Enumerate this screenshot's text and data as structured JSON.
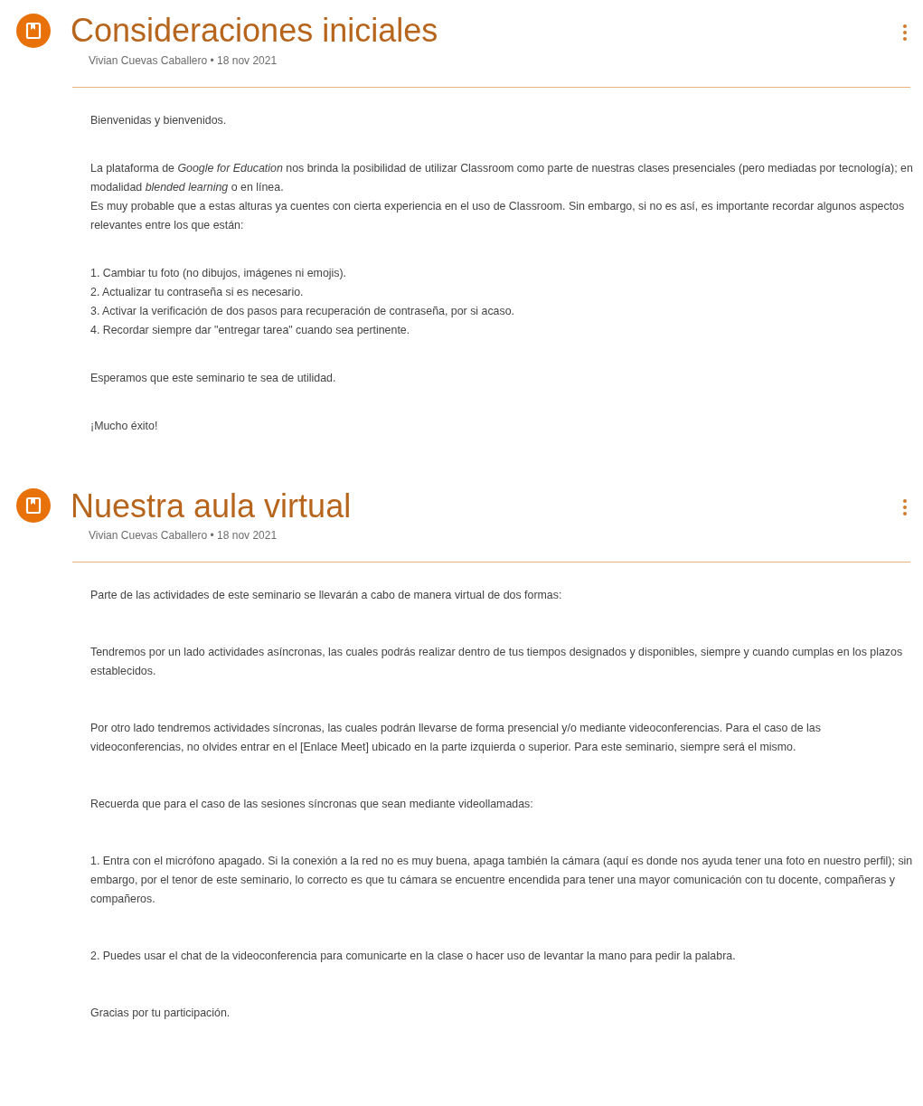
{
  "posts": [
    {
      "title": "Consideraciones iniciales",
      "author": "Vivian Cuevas Caballero",
      "date": "18 nov 2021",
      "separator": "•",
      "paragraphs": [
        {
          "lines": [
            "Bienvenidas y bienvenidos."
          ]
        },
        {
          "lines": [
            "La plataforma de *Google for Education* nos brinda la posibilidad de utilizar Classroom como parte de nuestras clases presenciales (pero mediadas por tecnología); en modalidad *blended learning* o en línea.",
            "Es muy probable que a estas alturas ya cuentes con cierta experiencia en el uso de Classroom. Sin embargo, si no es así, es importante recordar algunos aspectos relevantes entre los que están:"
          ]
        },
        {
          "lines": [
            "1. Cambiar tu foto (no dibujos, imágenes ni emojis).",
            "2. Actualizar tu contraseña si es necesario.",
            "3. Activar la verificación de dos pasos para recuperación de contraseña, por si acaso.",
            "4. Recordar siempre dar \"entregar tarea\" cuando sea pertinente."
          ]
        },
        {
          "lines": [
            "Esperamos que este seminario te sea de utilidad."
          ]
        },
        {
          "lines": [
            "¡Mucho éxito!"
          ]
        }
      ]
    },
    {
      "title": "Nuestra aula virtual",
      "author": "Vivian Cuevas Caballero",
      "date": "18 nov 2021",
      "separator": "•",
      "paragraphs": [
        {
          "lines": [
            "Parte de las actividades de este seminario se llevarán a cabo de manera virtual de dos formas:"
          ]
        },
        {
          "lines": [
            "Tendremos por un lado actividades asíncronas, las cuales podrás realizar dentro de tus tiempos designados y disponibles, siempre y cuando cumplas en los plazos establecidos."
          ]
        },
        {
          "lines": [
            "Por otro lado tendremos actividades síncronas, las cuales podrán llevarse de forma presencial y/o mediante videoconferencias. Para el caso de las videoconferencias, no olvides entrar en el [Enlace Meet] ubicado en la parte izquierda o superior. Para este seminario, siempre será el mismo."
          ]
        },
        {
          "lines": [
            "Recuerda que para el caso de las sesiones síncronas que sean mediante videollamadas:"
          ]
        },
        {
          "lines": [
            "1. Entra con el micrófono apagado. Si la conexión a la red no es muy buena, apaga también la cámara (aquí es donde nos ayuda tener una foto en nuestro perfil); sin embargo, por el tenor de este seminario, lo correcto es que tu cámara se encuentre encendida para tener una mayor comunicación con tu docente, compañeras y compañeros."
          ]
        },
        {
          "lines": [
            "2. Puedes usar el chat de la videoconferencia para comunicarte en la clase o hacer uso de levantar la mano para pedir la palabra."
          ]
        },
        {
          "lines": [
            "Gracias por tu participación."
          ]
        }
      ]
    }
  ]
}
